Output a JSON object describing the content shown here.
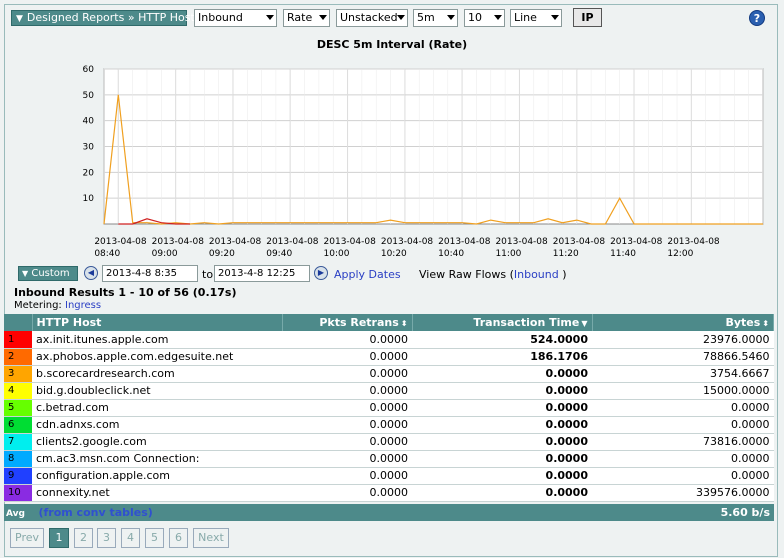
{
  "toolbar": {
    "breadcrumb": "Designed Reports » HTTP Host",
    "direction": "Inbound",
    "metric": "Rate",
    "stack": "Unstacked",
    "interval": "5m",
    "topn": "10",
    "chart_type": "Line",
    "ip_label": "IP",
    "help_label": "?"
  },
  "chart_data": {
    "type": "line",
    "title": "DESC 5m Interval (Rate)",
    "ylim": [
      0,
      60
    ],
    "yticks": [
      "10",
      "20",
      "30",
      "40",
      "50",
      "60"
    ],
    "xticks": [
      [
        "2013-04-08",
        "08:40"
      ],
      [
        "2013-04-08",
        "09:00"
      ],
      [
        "2013-04-08",
        "09:20"
      ],
      [
        "2013-04-08",
        "09:40"
      ],
      [
        "2013-04-08",
        "10:00"
      ],
      [
        "2013-04-08",
        "10:20"
      ],
      [
        "2013-04-08",
        "10:40"
      ],
      [
        "2013-04-08",
        "11:00"
      ],
      [
        "2013-04-08",
        "11:20"
      ],
      [
        "2013-04-08",
        "11:40"
      ],
      [
        "2013-04-08",
        "12:00"
      ]
    ],
    "series": [
      {
        "color": "#f0a020",
        "x": [
          "08:35",
          "08:40",
          "08:45",
          "08:50",
          "08:55",
          "09:00",
          "09:05",
          "09:10",
          "09:15",
          "09:20",
          "09:30",
          "09:40",
          "09:50",
          "10:00",
          "10:10",
          "10:15",
          "10:20",
          "10:30",
          "10:40",
          "10:45",
          "10:50",
          "10:55",
          "11:00",
          "11:05",
          "11:10",
          "11:15",
          "11:20",
          "11:25",
          "11:30",
          "11:35",
          "11:40",
          "11:50",
          "12:00",
          "12:10",
          "12:15",
          "12:20",
          "12:25"
        ],
        "values": [
          0,
          50,
          0.5,
          0.5,
          0,
          0.5,
          0,
          0.5,
          0,
          0.5,
          0.5,
          0.5,
          0.5,
          0.5,
          0.5,
          1.5,
          0.5,
          0.5,
          0.5,
          0,
          1.5,
          0.5,
          0.5,
          0.5,
          2,
          0.5,
          1.5,
          0,
          0,
          10,
          0,
          0,
          0,
          0,
          0,
          0,
          0
        ]
      },
      {
        "color": "#d02020",
        "x": [
          "08:40",
          "08:45",
          "08:50",
          "08:55",
          "09:00",
          "09:05"
        ],
        "values": [
          0,
          0,
          2,
          0.5,
          0,
          0
        ]
      }
    ]
  },
  "controls": {
    "custom_label": "Custom",
    "start": "2013-4-8 8:35",
    "to": "to",
    "end": "2013-4-8 12:25",
    "apply": "Apply Dates",
    "raw_prefix": "View Raw Flows (",
    "raw_link": "Inbound",
    "raw_suffix": ")"
  },
  "results": {
    "title": "Inbound Results 1 - 10 of 56 (0.17s)",
    "metering_label": "Metering:",
    "metering_value": "Ingress"
  },
  "table": {
    "headers": [
      "HTTP Host",
      "Pkts Retrans",
      "Transaction Time",
      "Bytes"
    ],
    "rows": [
      {
        "rank": "1",
        "color": "#ff0000",
        "host": "ax.init.itunes.apple.com",
        "retrans": "0.0000",
        "tt": "524.0000",
        "bytes": "23976.0000"
      },
      {
        "rank": "2",
        "color": "#ff6a00",
        "host": "ax.phobos.apple.com.edgesuite.net",
        "retrans": "0.0000",
        "tt": "186.1706",
        "bytes": "78866.5460"
      },
      {
        "rank": "3",
        "color": "#ffa500",
        "host": "b.scorecardresearch.com",
        "retrans": "0.0000",
        "tt": "0.0000",
        "bytes": "3754.6667"
      },
      {
        "rank": "4",
        "color": "#ffff00",
        "host": "bid.g.doubleclick.net",
        "retrans": "0.0000",
        "tt": "0.0000",
        "bytes": "15000.0000"
      },
      {
        "rank": "5",
        "color": "#66ff00",
        "host": "c.betrad.com",
        "retrans": "0.0000",
        "tt": "0.0000",
        "bytes": "0.0000"
      },
      {
        "rank": "6",
        "color": "#00dd33",
        "host": "cdn.adnxs.com",
        "retrans": "0.0000",
        "tt": "0.0000",
        "bytes": "0.0000"
      },
      {
        "rank": "7",
        "color": "#00eeee",
        "host": "clients2.google.com",
        "retrans": "0.0000",
        "tt": "0.0000",
        "bytes": "73816.0000"
      },
      {
        "rank": "8",
        "color": "#00aaff",
        "host": "cm.ac3.msn.com Connection:",
        "retrans": "0.0000",
        "tt": "0.0000",
        "bytes": "0.0000"
      },
      {
        "rank": "9",
        "color": "#2040ff",
        "host": "configuration.apple.com",
        "retrans": "0.0000",
        "tt": "0.0000",
        "bytes": "0.0000"
      },
      {
        "rank": "10",
        "color": "#8a2be2",
        "host": "connexity.net",
        "retrans": "0.0000",
        "tt": "0.0000",
        "bytes": "339576.0000"
      }
    ],
    "avg_label": "Avg",
    "avg_note": "(from conv tables)",
    "avg_value": "5.60 b/s"
  },
  "pager": {
    "prev": "Prev",
    "pages": [
      "1",
      "2",
      "3",
      "4",
      "5",
      "6"
    ],
    "next": "Next"
  }
}
